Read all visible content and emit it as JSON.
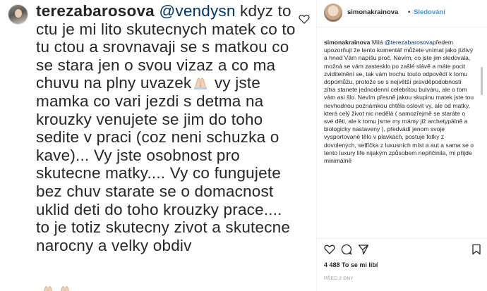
{
  "zoomed_comment": {
    "username": "terezabarosova",
    "mention": "@vendysn",
    "text": " kdyz to ctu je mi lito skutecnych matek co to tu ctou a srovnavaji se s matkou co se stara jen o svou vizaz a co ma chuvu na plny uvazek",
    "text_after_emoji": " vy jste mamka co vari jezdi s detma na krouzky venujete se jim do toho sedite v praci (coz neni schuzka o kave)... Vy jste osobnost pro skutecne matky.... Vy co fungujete bez chuv starate se o domacnost uklid deti do toho krouzky prace.... to je totiz skutecny zivot a skutecne narocny a velky obdiv",
    "emoji_icon": "folded-hands-icon",
    "like_icon": "heart-icon"
  },
  "post": {
    "header": {
      "username": "simonakrainova",
      "separator": "•",
      "follow_label": "Sledováni"
    },
    "caption": {
      "username": "simonakrainova",
      "lead": " Milá",
      "mention": "@terezabarosova",
      "text": "předem upozorňuji že tento komentář můžete vnímat jako jízlivý a hned Vám napíšu proč. Nevím, co jste jim sledovala, možná se vám zastesklo po zašlé slávě a máte pocit zviditelnění se, tak vám trochu touto odpovědí k tomu dopomůžu, protože se s největší pravděpodobností zítra stanete jednodenní celebritou bulváru, ale o tom vám asi šlo. Nevím přesně jakou skupinu matek jste tou nevhodnou poznámkou chtěla oslovit vy, ale od matky, která celý život nic nedělá ( samozřejmě se staráte o své děti, ale k tomu jsme my mámy již archetypálně a biologicky nastaveny ), předvádí jenom svoje vysportované tělo v plavkách, postuje fotky z dovolených, selfíčka z luxusních míst a aut a sama se o tento luxury life nijakým způsobem nepřičinila, mi přijde minimálně"
    },
    "actions": {
      "like_icon": "heart-icon",
      "comment_icon": "comment-icon",
      "share_icon": "share-icon",
      "save_icon": "bookmark-icon"
    },
    "likes_text": "4 488 To se mi líbí",
    "date_text": "PŘED 2 DNY"
  },
  "colors": {
    "text": "#262626",
    "link": "#003569",
    "follow": "#3897f0",
    "muted": "#999999"
  }
}
